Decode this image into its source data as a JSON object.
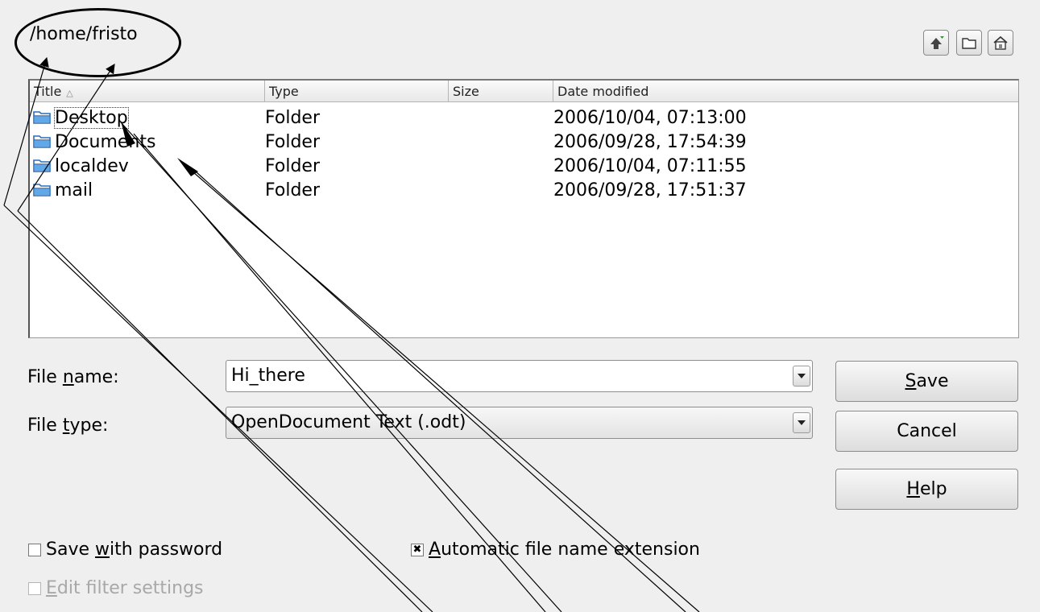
{
  "path": "/home/fristo",
  "toolbar": {
    "up_icon": "up-one-level-icon",
    "new_folder_icon": "new-folder-icon",
    "home_icon": "home-icon"
  },
  "table": {
    "columns": [
      "Title",
      "Type",
      "Size",
      "Date modified"
    ],
    "rows": [
      {
        "name": "Desktop",
        "type": "Folder",
        "size": "",
        "modified": "2006/10/04, 07:13:00"
      },
      {
        "name": "Documents",
        "type": "Folder",
        "size": "",
        "modified": "2006/09/28, 17:54:39"
      },
      {
        "name": "localdev",
        "type": "Folder",
        "size": "",
        "modified": "2006/10/04, 07:11:55"
      },
      {
        "name": "mail",
        "type": "Folder",
        "size": "",
        "modified": "2006/09/28, 17:51:37"
      }
    ]
  },
  "form": {
    "file_name_label_pre": "File ",
    "file_name_label_acc": "n",
    "file_name_label_post": "ame:",
    "file_name_value": "Hi_there",
    "file_type_label_pre": "File ",
    "file_type_label_acc": "t",
    "file_type_label_post": "ype:",
    "file_type_value": "OpenDocument Text (.odt)"
  },
  "buttons": {
    "save_acc": "S",
    "save_rest": "ave",
    "cancel": "Cancel",
    "help_acc": "H",
    "help_rest": "elp"
  },
  "options": {
    "save_password_pre": "Save ",
    "save_password_acc": "w",
    "save_password_post": "ith password",
    "save_password_checked": false,
    "auto_ext_acc": "A",
    "auto_ext_post": "utomatic file name extension",
    "auto_ext_checked": true,
    "auto_ext_mark": "✖",
    "edit_filter_acc": "E",
    "edit_filter_post": "dit filter settings",
    "edit_filter_checked": false
  },
  "colors": {
    "folder_blue": "#3f8fd8",
    "background": "#efefef"
  }
}
